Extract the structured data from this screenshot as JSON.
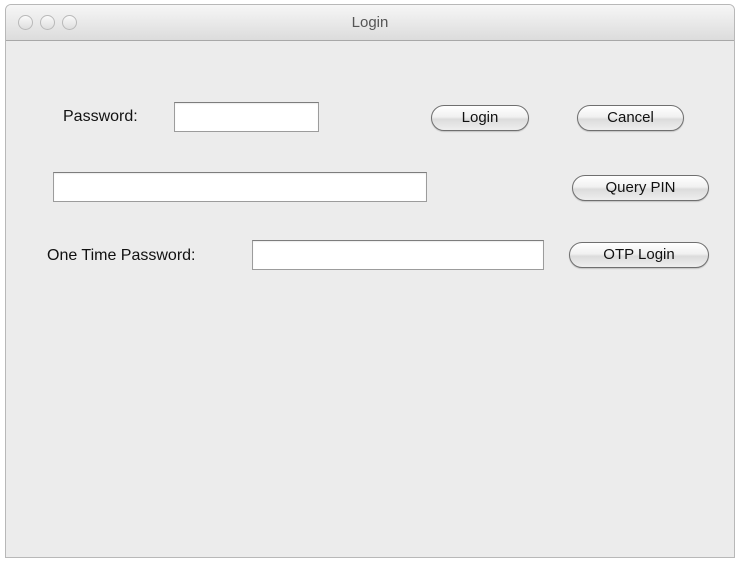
{
  "window": {
    "title": "Login"
  },
  "form": {
    "password_label": "Password:",
    "password_value": "",
    "pin_value": "",
    "otp_label": "One Time Password:",
    "otp_value": ""
  },
  "buttons": {
    "login": "Login",
    "cancel": "Cancel",
    "query_pin": "Query PIN",
    "otp_login": "OTP Login"
  },
  "colors": {
    "window_background": "#ececec",
    "field_background": "#ffffff"
  }
}
